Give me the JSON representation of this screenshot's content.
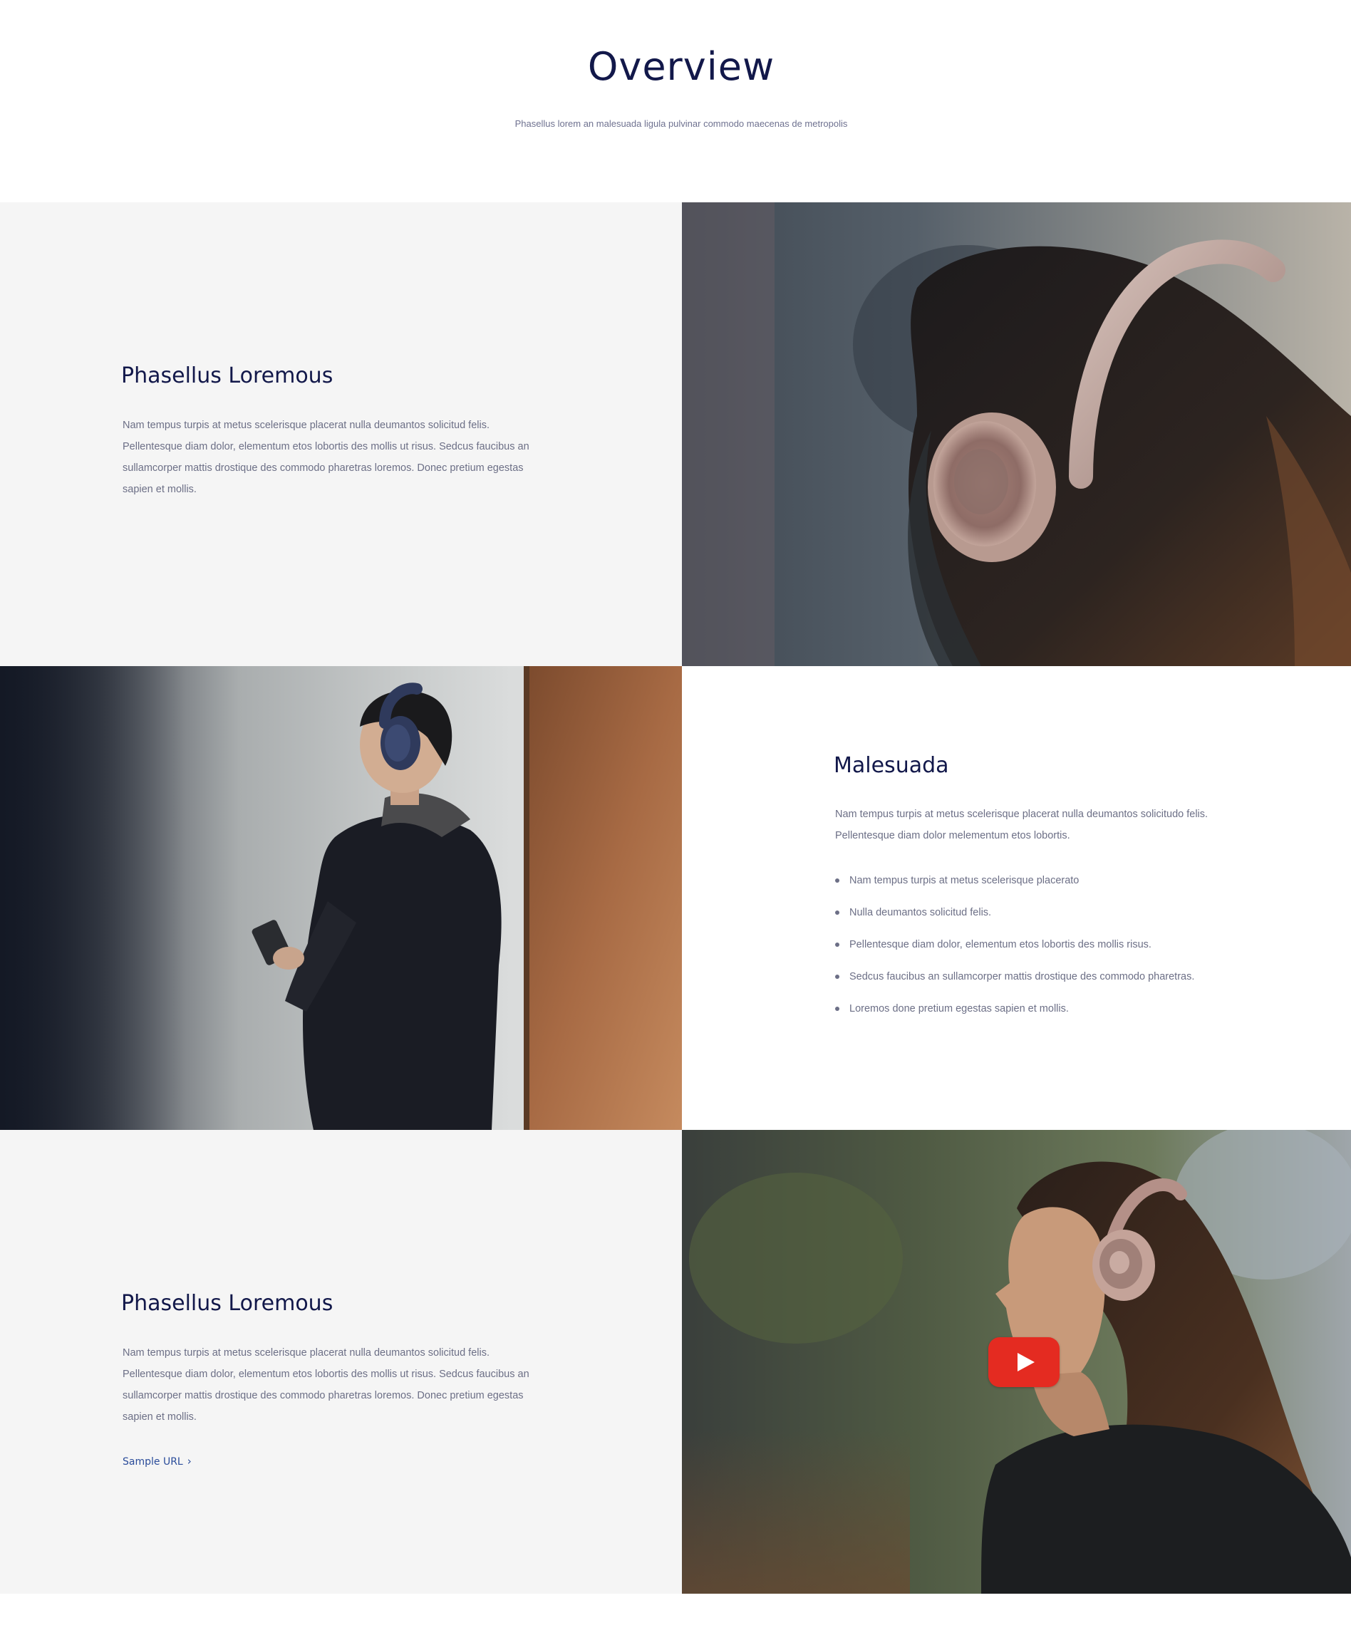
{
  "header": {
    "title": "Overview",
    "subtitle": "Phasellus lorem an malesuada ligula pulvinar commodo maecenas de metropolis"
  },
  "sections": [
    {
      "title": "Phasellus Loremous",
      "body": "Nam tempus turpis at metus scelerisque placerat nulla deumantos solicitud felis. Pellentesque diam dolor, elementum etos lobortis des mollis ut risus. Sedcus faucibus an sullamcorper mattis drostique des commodo pharetras loremos. Donec pretium egestas sapien et mollis.",
      "image": "woman-with-rose-gold-headphones-photo"
    },
    {
      "title": "Malesuada",
      "body": "Nam tempus turpis at metus scelerisque placerat nulla deumantos solicitudo felis. Pellentesque diam dolor melementum etos lobortis.",
      "bullets": [
        "Nam tempus turpis at metus scelerisque placerato",
        "Nulla deumantos solicitud felis.",
        "Pellentesque diam dolor, elementum etos lobortis des mollis risus.",
        "Sedcus faucibus an sullamcorper mattis drostique des commodo pharetras.",
        "Loremos done pretium egestas sapien et mollis."
      ],
      "image": "man-with-blue-headphones-holding-phone-photo"
    },
    {
      "title": "Phasellus Loremous",
      "body": "Nam tempus turpis at metus scelerisque placerat nulla deumantos solicitud felis. Pellentesque diam dolor, elementum etos lobortis des mollis ut risus. Sedcus faucibus an sullamcorper mattis drostique des commodo pharetras loremos. Donec pretium egestas sapien et mollis.",
      "link_label": "Sample URL",
      "link_icon": "chevron-right-icon",
      "image": "woman-with-headphones-video-thumbnail",
      "video_icon": "play-icon"
    }
  ],
  "colors": {
    "heading": "#12184a",
    "body_text": "#6c6f86",
    "link": "#2a4c9a",
    "panel_gray": "#f5f5f5",
    "play_button": "#e42b21"
  }
}
